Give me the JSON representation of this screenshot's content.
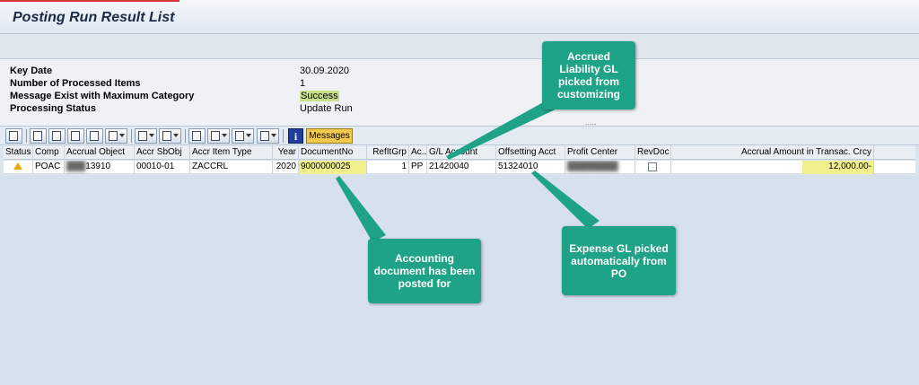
{
  "window": {
    "title": "Posting Run Result List"
  },
  "header": {
    "rows": [
      {
        "label": "Key Date",
        "value": "30.09.2020"
      },
      {
        "label": "Number of Processed Items",
        "value": "1"
      },
      {
        "label": "Message Exist with Maximum Category",
        "value": "Success"
      },
      {
        "label": "Processing Status",
        "value": "Update Run"
      }
    ],
    "more_indicator": "....."
  },
  "toolbar": {
    "messages_label": "Messages",
    "info_label": "i"
  },
  "grid": {
    "columns": [
      "Status",
      "Comp",
      "Accrual Object",
      "Accr SbObj",
      "Accr Item Type",
      "Year",
      "DocumentNo",
      "RefItGrp",
      "Ac..",
      "G/L Account",
      "Offsetting Acct",
      "Profit Center",
      "RevDoc",
      "Accrual Amount in Transac. Crcy"
    ],
    "rows": [
      {
        "comp": "POAC",
        "accrual_object": "13910",
        "sub_object": "00010-01",
        "item_type": "ZACCRL",
        "year": "2020",
        "document_no": "9000000025",
        "ref_item_group": "1",
        "acct_type": "PP",
        "gl_account": "21420040",
        "offsetting_acct": "51324010",
        "profit_center": "",
        "amount": "12,000.00-"
      }
    ]
  },
  "callouts": {
    "accrued_liability": "Accrued Liability GL picked from customizing",
    "accounting_doc": "Accounting document has been posted for",
    "expense_gl": "Expense GL picked automatically from PO"
  },
  "colors": {
    "callout": "#1ea386",
    "highlight": "#f2f08c",
    "success_highlight": "#c7e08a"
  }
}
